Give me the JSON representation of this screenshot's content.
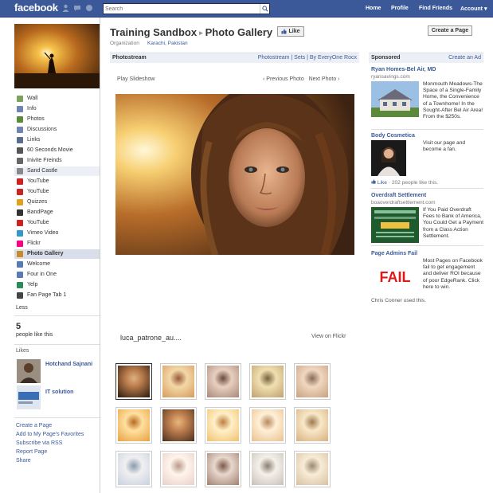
{
  "topbar": {
    "logo": "facebook",
    "search_placeholder": "Search",
    "nav": [
      "Home",
      "Profile",
      "Find Friends",
      "Account ▾"
    ]
  },
  "sidebar": {
    "items": [
      {
        "label": "Wall",
        "icon": "wall-icon",
        "color": "#7aa35d"
      },
      {
        "label": "Info",
        "icon": "info-icon",
        "color": "#6d84b4"
      },
      {
        "label": "Photos",
        "icon": "photos-icon",
        "color": "#5b8a3a"
      },
      {
        "label": "Discussions",
        "icon": "discussions-icon",
        "color": "#6d84b4"
      },
      {
        "label": "Links",
        "icon": "links-icon",
        "color": "#5a6e8c"
      },
      {
        "label": "60 Seconds Movie",
        "icon": "app-icon",
        "color": "#555555"
      },
      {
        "label": "Inivite Freinds",
        "icon": "app-icon",
        "color": "#666666"
      },
      {
        "label": "Sand Castle",
        "icon": "app-icon",
        "color": "#888888"
      },
      {
        "label": "YouTube",
        "icon": "youtube-icon",
        "color": "#cc2222"
      },
      {
        "label": "YouTube",
        "icon": "youtube-icon",
        "color": "#cc2222"
      },
      {
        "label": "Quizzes",
        "icon": "quizzes-icon",
        "color": "#e0a020"
      },
      {
        "label": "BandPage",
        "icon": "bandpage-icon",
        "color": "#333333"
      },
      {
        "label": "YouTube",
        "icon": "youtube-icon",
        "color": "#cc2222"
      },
      {
        "label": "Vimeo Video",
        "icon": "vimeo-icon",
        "color": "#3399cc"
      },
      {
        "label": "Flickr",
        "icon": "flickr-icon",
        "color": "#ff0084"
      },
      {
        "label": "Photo Gallery",
        "icon": "gallery-icon",
        "color": "#c88a2a"
      },
      {
        "label": "Welcome",
        "icon": "welcome-icon",
        "color": "#5a7ab4"
      },
      {
        "label": "Four in One",
        "icon": "app-icon",
        "color": "#5a7ab4"
      },
      {
        "label": "Yelp",
        "icon": "yelp-icon",
        "color": "#2e8b57"
      },
      {
        "label": "Fan Page Tab 1",
        "icon": "app-icon",
        "color": "#444444"
      }
    ],
    "selected_index": 15,
    "hover_index": 7,
    "less": "Less",
    "likes_count": "5",
    "likes_text": "people like this",
    "likes_heading": "Likes",
    "liked_pages": [
      {
        "name": "Hotchand Sajnani"
      },
      {
        "name": "IT solution"
      }
    ],
    "footer_links": [
      "Create a Page",
      "Add to My Page's Favorites",
      "Subscribe via RSS",
      "Report Page",
      "Share"
    ]
  },
  "header": {
    "page_name": "Training Sandbox",
    "separator": "▸",
    "section": "Photo Gallery",
    "like_button": "Like",
    "category": "Organization",
    "location": "Karachi, Pakistan",
    "create_page_button": "Create a Page"
  },
  "photostream": {
    "title": "Photostream",
    "links": "Photostream  |  Sets  |  By EveryOne Rocx",
    "play_slideshow": "Play Slideshow",
    "nav": "‹ Previous Photo   Next Photo ›",
    "user": "luca_patrone_au....",
    "view_on_flickr": "View on Flickr"
  },
  "sponsored": {
    "heading": "Sponsored",
    "create_ad": "Create an Ad",
    "ads": [
      {
        "title": "Ryan Homes-Bel Air, MD",
        "domain": "ryansavings.com",
        "body": "Monmouth Meadows-The Space of a Single-Family Home, the Convenience of a Townhome! In the Sought-After Bel Air Area! From the $250s."
      },
      {
        "title": "Body Cosmetica",
        "body": "Visit our page and become a fan.",
        "like": "Like",
        "count": "· 202 people like this."
      },
      {
        "title": "Overdraft Settlement",
        "domain": "boaoverdraftsettlement.com",
        "body": "If You Paid Overdraft Fees to Bank of America, You Could Get a Payment from a Class Action Settlement."
      },
      {
        "title": "Page Admins Fail",
        "body": "Most Pages on Facebook fail to get engagement and deliver ROI because of poor EdgeRank. Click here to win.",
        "fail_word": "FAIL",
        "used_by": "Chris Conner used this."
      }
    ]
  }
}
